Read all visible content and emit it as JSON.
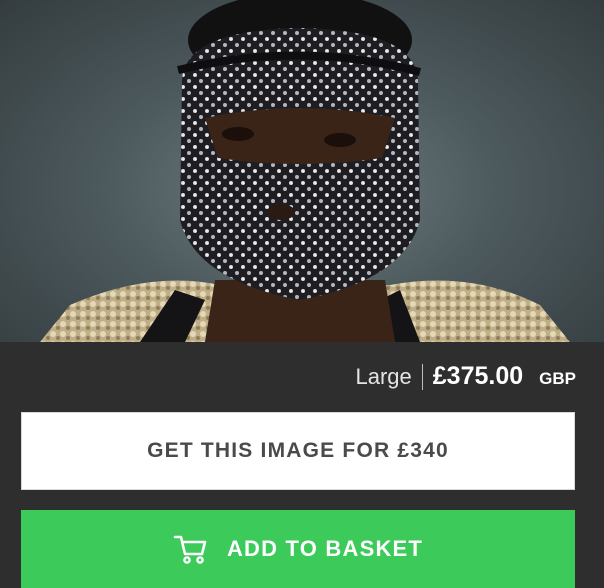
{
  "product": {
    "image_alt": "Person wearing a black rhinestone-studded face mask and sequined jacket"
  },
  "pricing": {
    "size": "Large",
    "amount": "£375.00",
    "currency": "GBP"
  },
  "actions": {
    "get_image_label": "GET THIS IMAGE FOR £340",
    "add_to_basket_label": "ADD TO BASKET",
    "basket_icon": "shopping-cart-icon"
  },
  "colors": {
    "accent_green": "#3ccb5a",
    "panel_background": "#2e2e2e"
  }
}
